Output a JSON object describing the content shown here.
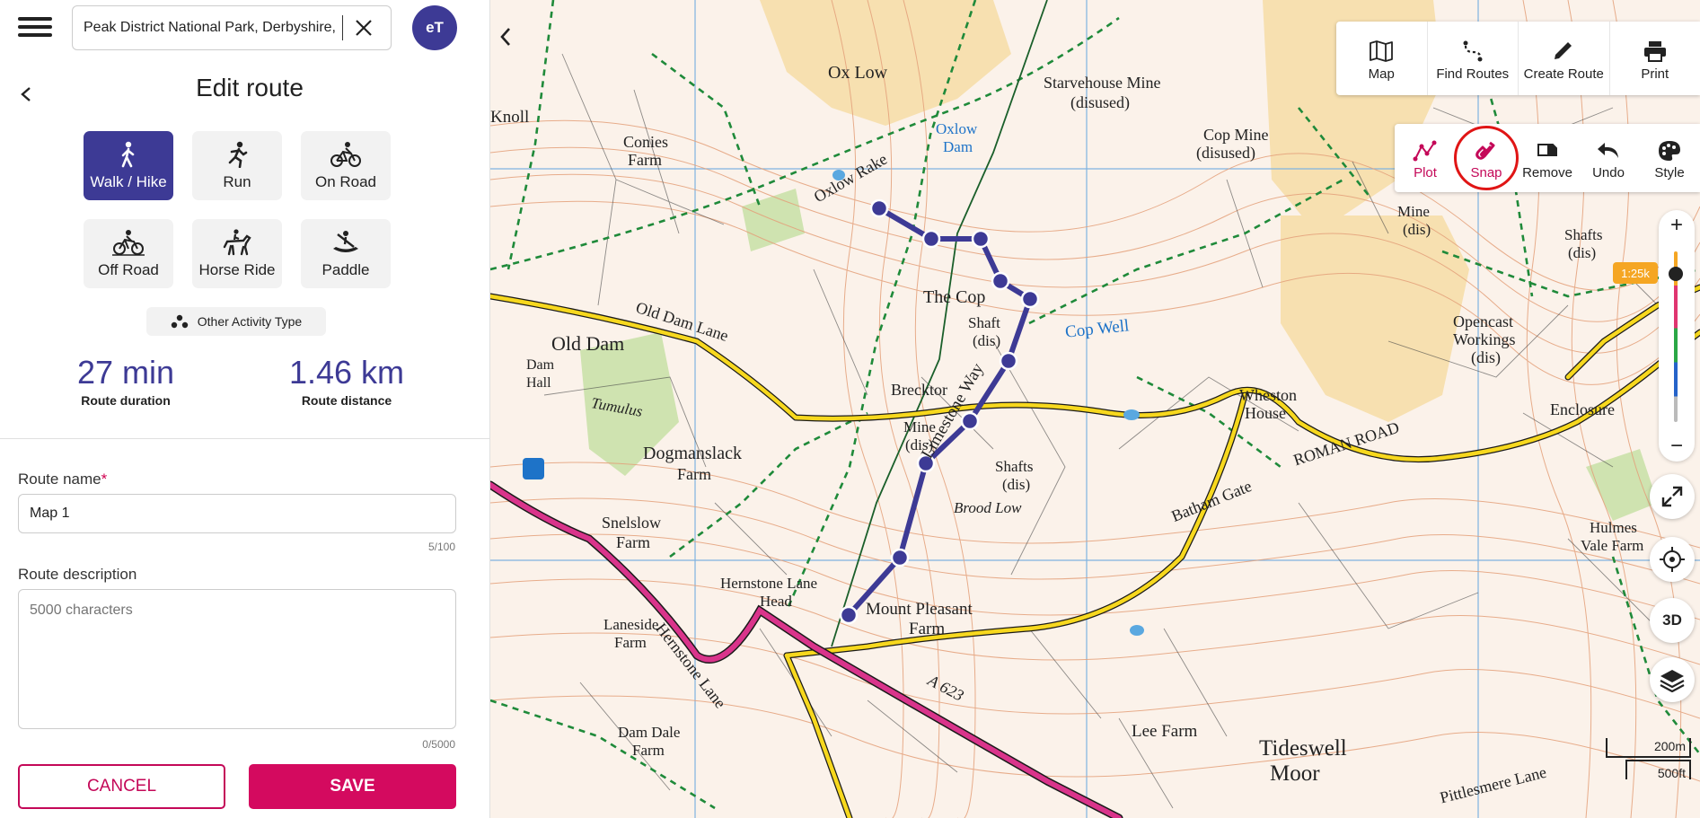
{
  "header": {
    "search_value": "Peak District National Park, Derbyshire, England",
    "avatar_initials": "eT"
  },
  "panel": {
    "title": "Edit route",
    "activities": [
      {
        "label": "Walk / Hike",
        "icon": "walk-icon",
        "active": true
      },
      {
        "label": "Run",
        "icon": "run-icon",
        "active": false
      },
      {
        "label": "On Road",
        "icon": "road-bike-icon",
        "active": false
      },
      {
        "label": "Off Road",
        "icon": "mountain-bike-icon",
        "active": false
      },
      {
        "label": "Horse Ride",
        "icon": "horse-icon",
        "active": false
      },
      {
        "label": "Paddle",
        "icon": "paddle-icon",
        "active": false
      }
    ],
    "other_activity_label": "Other Activity Type",
    "duration_value": "27 min",
    "duration_label": "Route duration",
    "distance_value": "1.46 km",
    "distance_label": "Route distance",
    "route_name_label": "Route name",
    "route_name_required": "*",
    "route_name_value": "Map 1",
    "route_name_counter": "5/100",
    "route_desc_label": "Route description",
    "route_desc_placeholder": "5000 characters",
    "route_desc_counter": "0/5000",
    "cancel_label": "CANCEL",
    "save_label": "SAVE"
  },
  "map": {
    "toolbar": [
      {
        "label": "Map",
        "icon": "map-icon"
      },
      {
        "label": "Find Routes",
        "icon": "find-routes-icon"
      },
      {
        "label": "Create Route",
        "icon": "pencil-icon"
      },
      {
        "label": "Print",
        "icon": "printer-icon"
      }
    ],
    "draw_tools": [
      {
        "label": "Plot",
        "icon": "plot-icon",
        "accent": true
      },
      {
        "label": "Snap",
        "icon": "snap-magnet-icon",
        "accent": true,
        "highlighted": true
      },
      {
        "label": "Remove",
        "icon": "eraser-icon",
        "accent": false
      },
      {
        "label": "Undo",
        "icon": "undo-icon",
        "accent": false
      },
      {
        "label": "Style",
        "icon": "palette-icon",
        "accent": false
      }
    ],
    "zoom_in": "+",
    "zoom_out": "−",
    "zoom_badge": "1:25k",
    "three_d_label": "3D",
    "scale_metric": "200m",
    "scale_imperial": "500ft",
    "place_labels": [
      {
        "text": "Ox Low"
      },
      {
        "text": "Starvehouse Mine"
      },
      {
        "text": "(disused)"
      },
      {
        "text": "Cop Mine"
      },
      {
        "text": "(disused)"
      },
      {
        "text": "Conies"
      },
      {
        "text": "Farm"
      },
      {
        "text": "Oxlow Rake"
      },
      {
        "text": "Old Dam Lane"
      },
      {
        "text": "Old Dam"
      },
      {
        "text": "Dam"
      },
      {
        "text": "Hall"
      },
      {
        "text": "Tumulus"
      },
      {
        "text": "Dogmanslack"
      },
      {
        "text": "Farm"
      },
      {
        "text": "The Cop"
      },
      {
        "text": "Shaft"
      },
      {
        "text": "(dis)"
      },
      {
        "text": "Cop Well"
      },
      {
        "text": "Brecktor"
      },
      {
        "text": "Mine"
      },
      {
        "text": "(dis)"
      },
      {
        "text": "Limestone Way"
      },
      {
        "text": "Shafts"
      },
      {
        "text": "(dis)"
      },
      {
        "text": "Brood Low"
      },
      {
        "text": "Snelslow"
      },
      {
        "text": "Farm"
      },
      {
        "text": "Hernstone Lane"
      },
      {
        "text": "Head"
      },
      {
        "text": "Mount Pleasant"
      },
      {
        "text": "Farm"
      },
      {
        "text": "Laneside"
      },
      {
        "text": "Farm"
      },
      {
        "text": "Hernstone Lane"
      },
      {
        "text": "A 623"
      },
      {
        "text": "Dam Dale"
      },
      {
        "text": "Farm"
      },
      {
        "text": "Lee Farm"
      },
      {
        "text": "Tideswell"
      },
      {
        "text": "Moor"
      },
      {
        "text": "Wheston"
      },
      {
        "text": "House"
      },
      {
        "text": "Batham Gate"
      },
      {
        "text": "ROMAN ROAD"
      },
      {
        "text": "Opencast"
      },
      {
        "text": "Workings"
      },
      {
        "text": "(dis)"
      },
      {
        "text": "Enclosure"
      },
      {
        "text": "Hulmes"
      },
      {
        "text": "Vale Farm"
      },
      {
        "text": "Mine"
      },
      {
        "text": "(dis)"
      },
      {
        "text": "Shafts"
      },
      {
        "text": "(dis)"
      },
      {
        "text": "Pittlesmere Lane"
      },
      {
        "text": "Oxlow"
      },
      {
        "text": "Dam"
      },
      {
        "text": "Knoll"
      }
    ]
  },
  "colors": {
    "brand": "#3d3a95",
    "accent": "#d40a5f",
    "route": "#3d3a95",
    "highlight_ring": "#e01515"
  }
}
